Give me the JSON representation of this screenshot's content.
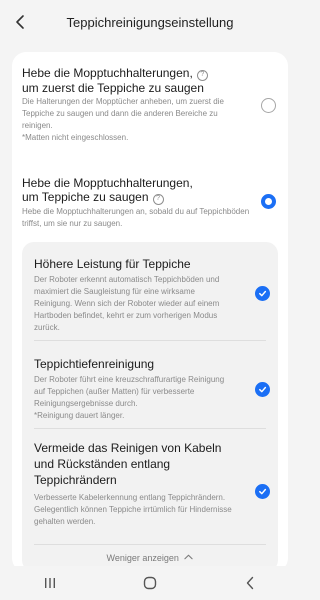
{
  "header": {
    "title": "Teppichreinigungseinstellung"
  },
  "options": [
    {
      "title_line1": "Hebe die Mopptuchhalterungen,",
      "title_line2": "um zuerst die Teppiche zu saugen",
      "description": "Die Halterungen der Mopptücher anheben, um zuerst die Teppiche zu saugen und dann die anderen Bereiche zu reinigen.",
      "note": "*Matten nicht eingeschlossen.",
      "selected": false
    },
    {
      "title_line1": "Hebe die Mopptuchhalterungen,",
      "title_line2": "um Teppiche zu saugen",
      "description": "Hebe die Mopptuchhalterungen an, sobald du auf Teppichböden triffst, um sie nur zu saugen.",
      "selected": true
    }
  ],
  "sub_options": [
    {
      "title": "Höhere Leistung für Teppiche",
      "description": "Der Roboter erkennt automatisch Teppichböden und maximiert die Saugleistung für eine wirksame Reinigung. Wenn sich der Roboter wieder auf einem Hartboden befindet, kehrt er zum vorherigen Modus zurück.",
      "checked": true
    },
    {
      "title": "Teppichtiefenreinigung",
      "description": "Der Roboter führt eine kreuzschraffurartige Reinigung auf Teppichen (außer Matten) für verbesserte Reinigungsergebnisse durch.",
      "note": "*Reinigung dauert länger.",
      "checked": true
    },
    {
      "title": "Vermeide das Reinigen von Kabeln und Rückständen entlang Teppichrändern",
      "description": "Verbesserte Kabelerkennung entlang Teppichrändern. Gelegentlich können Teppiche irrtümlich für Hindernisse gehalten werden.",
      "checked": true
    }
  ],
  "show_less_label": "Weniger anzeigen",
  "colors": {
    "accent": "#1b6ff5",
    "background": "#f4f4f4",
    "card": "#ffffff",
    "subpanel": "#f2f2f2"
  },
  "icons": {
    "back": "chevron-left-icon",
    "help": "question-circle-icon",
    "check": "checkmark-icon",
    "recents": "recents-icon",
    "home": "home-icon",
    "back_nav": "back-icon"
  }
}
